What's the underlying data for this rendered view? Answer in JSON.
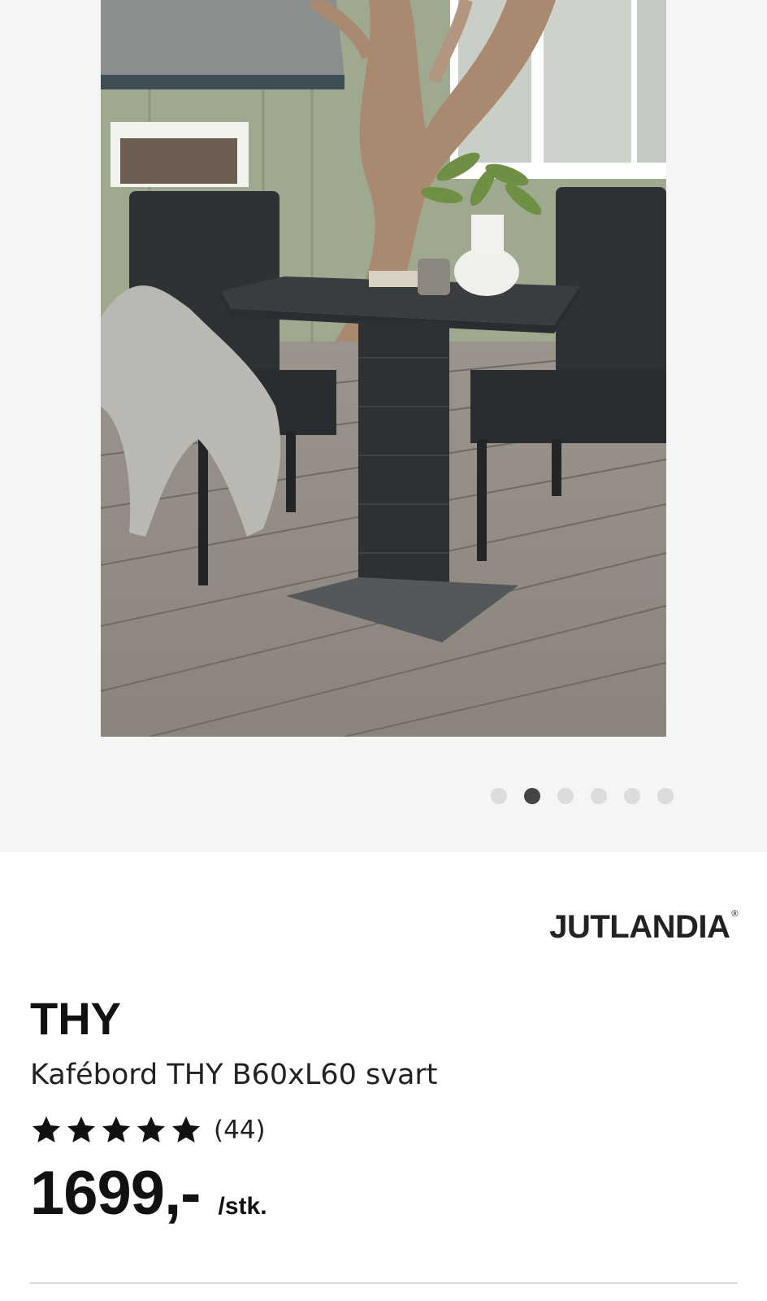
{
  "gallery": {
    "image_alt": "Kafébord THY B60xL60 svart",
    "slide_count": 6,
    "active_index": 1
  },
  "brand": {
    "name": "JUTLANDIA",
    "mark": "®"
  },
  "product": {
    "name": "THY",
    "description": "Kafébord THY B60xL60 svart",
    "rating_stars": 5,
    "review_count": "(44)",
    "price": "1699,-",
    "price_unit": "/stk."
  },
  "colors": {
    "gallery_bg": "#f5f5f5",
    "dot_inactive": "#dcdcdc",
    "dot_active": "#454545",
    "text": "#111111"
  }
}
